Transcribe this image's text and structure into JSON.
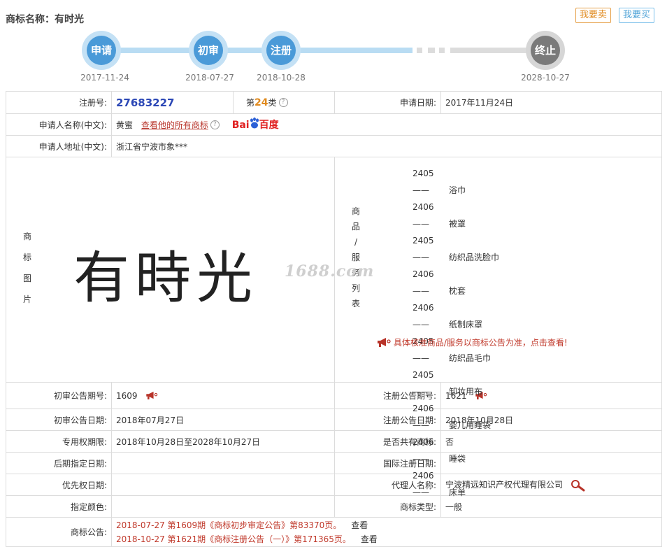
{
  "header": {
    "title_label": "商标名称：",
    "title_value": "有时光",
    "sell_label": "我要卖",
    "buy_label": "我要买"
  },
  "timeline": {
    "steps": [
      {
        "label": "申请",
        "date": "2017-11-24"
      },
      {
        "label": "初审",
        "date": "2018-07-27"
      },
      {
        "label": "注册",
        "date": "2018-10-28"
      },
      {
        "label": "终止",
        "date": "2028-10-27"
      }
    ]
  },
  "info": {
    "reg_no_label": "注册号:",
    "reg_no": "27683227",
    "class_prefix": "第",
    "class_num": "24",
    "class_suffix": "类",
    "apply_date_label": "申请日期:",
    "apply_date": "2017年11月24日",
    "applicant_label": "申请人名称(中文):",
    "applicant": "黄蜜",
    "applicant_link": "查看他的所有商标",
    "baidu_a": "Bai",
    "baidu_b": "百度",
    "address_label": "申请人地址(中文):",
    "address": "浙江省宁波市象***",
    "image_label_chars": [
      "商",
      "标",
      "图",
      "片"
    ],
    "mark_text": "有時光",
    "goods_label_chars": [
      "商",
      "品",
      "/",
      "服",
      "务",
      "列",
      "表"
    ],
    "goods": [
      {
        "code": "2405——",
        "name": "浴巾"
      },
      {
        "code": "2406——",
        "name": "被罩"
      },
      {
        "code": "2405——",
        "name": "纺织品洗脸巾"
      },
      {
        "code": "2406——",
        "name": "枕套"
      },
      {
        "code": "2406——",
        "name": "纸制床罩"
      },
      {
        "code": "2405——",
        "name": "纺织品毛巾"
      },
      {
        "code": "2405——",
        "name": "卸妆用布"
      },
      {
        "code": "2406——",
        "name": "婴儿用睡袋"
      },
      {
        "code": "2406——",
        "name": "睡袋"
      },
      {
        "code": "2406——",
        "name": "床单"
      }
    ],
    "goods_notice": "具体核准商品/服务以商标公告为准，点击查看!",
    "watermark": "1688.com",
    "prelim_no_label": "初审公告期号:",
    "prelim_no": "1609",
    "reg_notice_no_label": "注册公告期号:",
    "reg_notice_no": "1621",
    "prelim_date_label": "初审公告日期:",
    "prelim_date": "2018年07月27日",
    "reg_notice_date_label": "注册公告日期:",
    "reg_notice_date": "2018年10月28日",
    "exclusive_label": "专用权期限:",
    "exclusive": "2018年10月28日至2028年10月27日",
    "shared_label": "是否共有商标:",
    "shared": "否",
    "later_label": "后期指定日期:",
    "later": "",
    "intl_label": "国际注册日期:",
    "intl": "",
    "priority_label": "优先权日期:",
    "priority": "",
    "agent_label": "代理人名称:",
    "agent": "宁波精远知识产权代理有限公司",
    "color_label": "指定颜色:",
    "color": "",
    "type_label": "商标类型:",
    "type": "一般",
    "gazette_label": "商标公告:",
    "gazettes": [
      {
        "text": "2018-07-27 第1609期《商标初步审定公告》第83370页。",
        "view": "查看"
      },
      {
        "text": "2018-10-27 第1621期《商标注册公告（一）》第171365页。",
        "view": "查看"
      }
    ]
  }
}
